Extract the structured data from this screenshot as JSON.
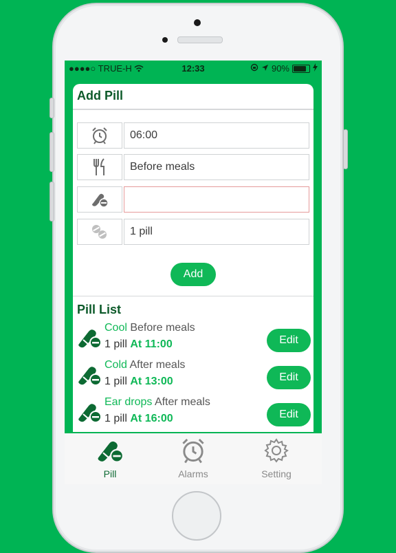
{
  "status": {
    "carrier": "●●●●○ TRUE-H",
    "time": "12:33",
    "battery": "90%",
    "battery_level": 0.9
  },
  "add_pill": {
    "title": "Add Pill",
    "rows": [
      {
        "icon": "alarm-clock-icon",
        "value": "06:00"
      },
      {
        "icon": "fork-knife-icon",
        "value": "Before meals"
      },
      {
        "icon": "pill-capsule-icon",
        "value": ""
      },
      {
        "icon": "tablets-icon",
        "value": "1 pill"
      }
    ],
    "add_label": "Add"
  },
  "pill_list": {
    "title": "Pill List",
    "items": [
      {
        "name": "Cool",
        "meal": "Before meals",
        "dose": "1 pill",
        "time": "At 11:00",
        "edit_label": "Edit"
      },
      {
        "name": "Cold",
        "meal": "After meals",
        "dose": "1 pill",
        "time": "At 13:00",
        "edit_label": "Edit"
      },
      {
        "name": "Ear drops",
        "meal": "After meals",
        "dose": "1 pill",
        "time": "At 16:00",
        "edit_label": "Edit"
      }
    ]
  },
  "tabs": [
    {
      "label": "Pill",
      "icon": "pill-capsule-icon",
      "active": true
    },
    {
      "label": "Alarms",
      "icon": "alarm-clock-icon",
      "active": false
    },
    {
      "label": "Setting",
      "icon": "gear-icon",
      "active": false
    }
  ],
  "colors": {
    "background": "#00b454",
    "accent": "#0fb857",
    "title": "#0d5a2a",
    "active_tab": "#0d6a33",
    "inactive_tab": "#8a8a8a"
  }
}
